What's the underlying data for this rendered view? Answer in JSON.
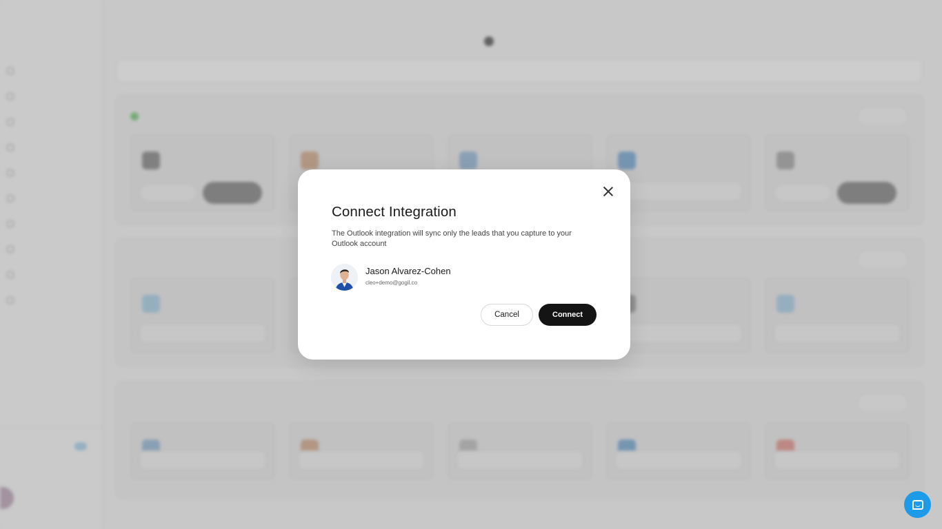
{
  "modal": {
    "title": "Connect Integration",
    "description": "The Outlook integration will sync only the leads that you capture to your Outlook account",
    "user": {
      "name": "Jason Alvarez-Cohen",
      "email": "cleo+demo@gogil.co"
    },
    "cancel_label": "Cancel",
    "connect_label": "Connect"
  },
  "colors": {
    "primary_button": "#141414",
    "chat_button": "#1e9be8"
  },
  "icons": {
    "close": "close-icon",
    "chat": "chat-icon"
  }
}
